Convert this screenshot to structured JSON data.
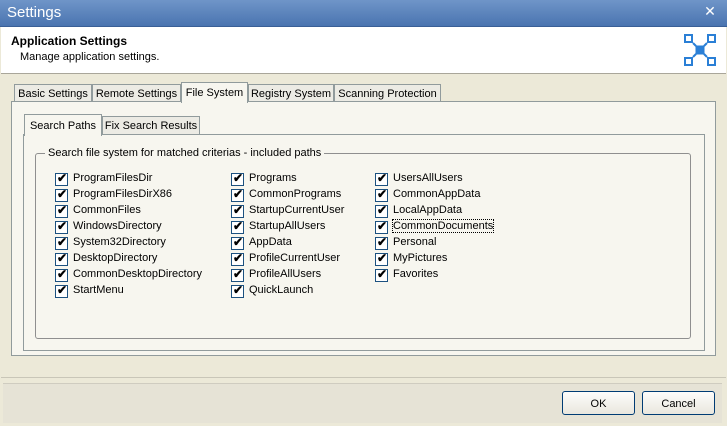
{
  "window": {
    "title": "Settings",
    "close_symbol": "✕"
  },
  "header": {
    "title": "Application Settings",
    "subtitle": "Manage application settings."
  },
  "tabs": [
    {
      "label": "Basic Settings",
      "active": false
    },
    {
      "label": "Remote Settings",
      "active": false
    },
    {
      "label": "File System",
      "active": true
    },
    {
      "label": "Registry System",
      "active": false
    },
    {
      "label": "Scanning Protection",
      "active": false
    }
  ],
  "subtabs": [
    {
      "label": "Search Paths",
      "active": true
    },
    {
      "label": "Fix Search Results",
      "active": false
    }
  ],
  "group": {
    "legend": "Search file system for matched criterias - included paths"
  },
  "columns": [
    [
      {
        "label": "ProgramFilesDir",
        "checked": true
      },
      {
        "label": "ProgramFilesDirX86",
        "checked": true
      },
      {
        "label": "CommonFiles",
        "checked": true
      },
      {
        "label": "WindowsDirectory",
        "checked": true
      },
      {
        "label": "System32Directory",
        "checked": true
      },
      {
        "label": "DesktopDirectory",
        "checked": true
      },
      {
        "label": "CommonDesktopDirectory",
        "checked": true
      },
      {
        "label": "StartMenu",
        "checked": true
      }
    ],
    [
      {
        "label": "Programs",
        "checked": true
      },
      {
        "label": "CommonPrograms",
        "checked": true
      },
      {
        "label": "StartupCurrentUser",
        "checked": true
      },
      {
        "label": "StartupAllUsers",
        "checked": true
      },
      {
        "label": "AppData",
        "checked": true
      },
      {
        "label": "ProfileCurrentUser",
        "checked": true
      },
      {
        "label": "ProfileAllUsers",
        "checked": true
      },
      {
        "label": "QuickLaunch",
        "checked": true
      }
    ],
    [
      {
        "label": "UsersAllUsers",
        "checked": true
      },
      {
        "label": "CommonAppData",
        "checked": true
      },
      {
        "label": "LocalAppData",
        "checked": true
      },
      {
        "label": "CommonDocuments",
        "checked": true,
        "focused": true
      },
      {
        "label": "Personal",
        "checked": true
      },
      {
        "label": "MyPictures",
        "checked": true
      },
      {
        "label": "Favorites",
        "checked": true
      }
    ]
  ],
  "buttons": {
    "ok": "OK",
    "cancel": "Cancel"
  },
  "icons": {
    "logo": "app-logo-icon",
    "check": "✔"
  },
  "colors": {
    "titlebar": "#4a74b0",
    "logo": "#2a7fd6"
  }
}
